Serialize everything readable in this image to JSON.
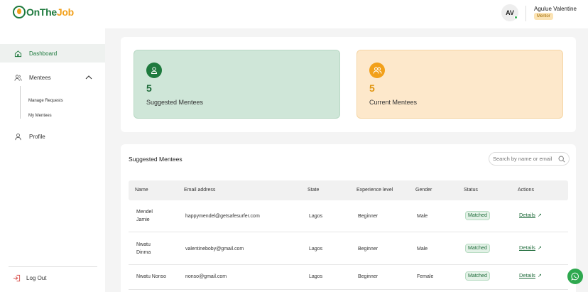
{
  "brand": {
    "logo_text_main": "OnThe",
    "logo_text_accent": "Job"
  },
  "user": {
    "initials": "AV",
    "name": "Agulue Valentine",
    "role": "Mentor"
  },
  "sidebar": {
    "items": [
      {
        "label": "Dashboard",
        "icon": "home-icon",
        "active": true
      },
      {
        "label": "Mentees",
        "icon": "users-icon",
        "expanded": true
      },
      {
        "label": "Profile",
        "icon": "user-icon"
      }
    ],
    "sub_items": [
      {
        "label": "Manage Requests"
      },
      {
        "label": "My Mentees"
      }
    ],
    "logout_label": "Log Out"
  },
  "stats": [
    {
      "value": "5",
      "label": "Suggested Mentees",
      "icon": "user-icon"
    },
    {
      "value": "5",
      "label": "Current Mentees",
      "icon": "users-icon"
    }
  ],
  "table": {
    "title": "Suggested Mentees",
    "search_placeholder": "Search by name or email",
    "columns": [
      "Name",
      "Email address",
      "State",
      "Experience level",
      "Gender",
      "Status",
      "Actions"
    ],
    "rows": [
      {
        "name_line1": "Mendel",
        "name_line2": "Jamie",
        "email": "happymendel@getsafesurfer.com",
        "state": "Lagos",
        "experience": "Beginner",
        "gender": "Male",
        "status": "Matched",
        "action": "Details"
      },
      {
        "name_line1": "Nwatu",
        "name_line2": "Dinma",
        "email": "valentineboby@gmail.com",
        "state": "Lagos",
        "experience": "Beginner",
        "gender": "Male",
        "status": "Matched",
        "action": "Details"
      },
      {
        "name_line1": "Nwatu Nonso",
        "name_line2": "",
        "email": "nonso@gmail.com",
        "state": "Lagos",
        "experience": "Beginner",
        "gender": "Female",
        "status": "Matched",
        "action": "Details"
      }
    ]
  },
  "colors": {
    "brand_green": "#1e7a3e",
    "brand_orange": "#f2a01a",
    "whatsapp_green": "#2ea84e"
  },
  "fab": {
    "icon": "whatsapp-icon"
  }
}
